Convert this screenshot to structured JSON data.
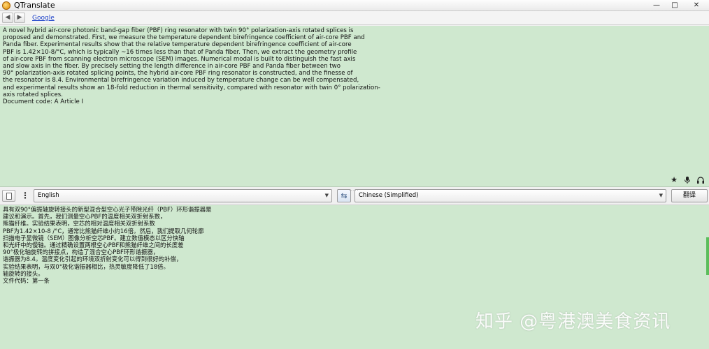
{
  "window": {
    "title": "QTranslate",
    "controls": {
      "minimize": "—",
      "maximize": "□",
      "close": "✕"
    }
  },
  "nav": {
    "back": "◀",
    "forward": "▶",
    "provider": "Google"
  },
  "source": {
    "text": "A novel hybrid air-core photonic band-gap fiber (PBF) ring resonator with twin 90° polarization-axis rotated splices is\nproposed and demonstrated. First, we measure the temperature dependent birefringence coefficient of air-core PBF and\nPanda fiber. Experimental results show that the relative temperature dependent birefringence coefficient of air-core\nPBF is 1.42×10-8/°C, which is typically ~16 times less than that of Panda fiber. Then, we extract the geometry profile\nof air-core PBF from scanning electron microscope (SEM) images. Numerical modal is built to distinguish the fast axis\nand slow axis in the fiber. By precisely setting the length difference in air-core PBF and Panda fiber between two\n90° polarization-axis rotated splicing points, the hybrid air-core PBF ring resonator is constructed, and the finesse of\nthe resonator is 8.4. Environmental birefringence variation induced by temperature change can be well compensated,\nand experimental results show an 18-fold reduction in thermal sensitivity, compared with resonator with twin 0° polarization-\naxis rotated splices.\nDocument code: A Article I",
    "icons": [
      "star-icon",
      "microphone-icon",
      "headphones-icon"
    ]
  },
  "langbar": {
    "source_language": "English",
    "target_language": "Chinese (Simplified)",
    "swap": "⇆",
    "translate_label": "翻译",
    "splitter": "....."
  },
  "result": {
    "text": "具有双90°偏振轴旋转接头的新型混合型空心光子带隙光纤（PBF）环形谐振器是\n建议和演示。首先，我们测量空心PBF的温度相关双折射系数，\n熊猫纤维。实验结果表明，空芯的相对温度相关双折射系数\nPBF为1.42×10-8 /°C，通常比熊猫纤维小约16倍。然后，我们提取几何轮廓\n扫描电子显微镜（SEM）图像分析空芯PBF。建立数值模态以区分快轴\n和光纤中的慢轴。通过精确设置两根空心PBF和熊猫纤维之间的长度差\n90°极化轴旋转的拼接点，构造了混合空心PBF环形谐振器，\n谐振器为8.4。温度变化引起的环境双折射变化可以得到很好的补偿，\n实验结果表明，与双0°极化谐振器相比，热灵敏度降低了18倍。\n轴旋转的接头。\n文件代码：第一条",
    "watermark": "知乎 @粤港澳美食资讯"
  }
}
